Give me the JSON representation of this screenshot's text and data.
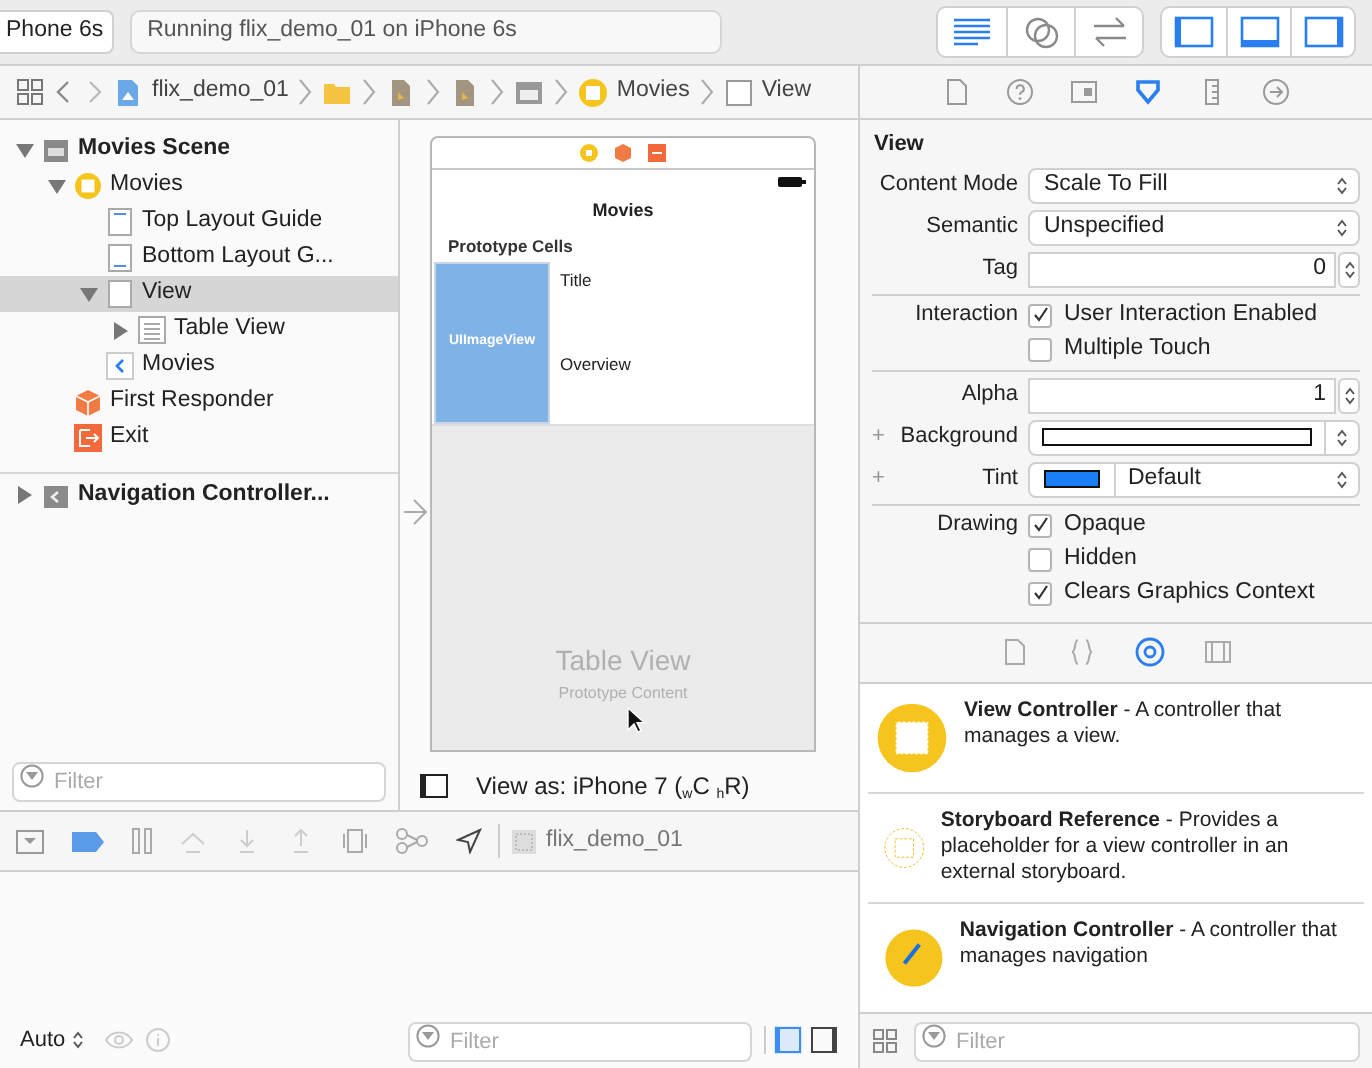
{
  "toolbar": {
    "scheme": "Phone 6s",
    "status": "Running flix_demo_01 on iPhone 6s",
    "editors": [
      {
        "kind": "standard",
        "selected": true
      },
      {
        "kind": "assistant",
        "selected": false
      },
      {
        "kind": "version",
        "selected": false
      }
    ],
    "panels": [
      {
        "kind": "left",
        "on": true
      },
      {
        "kind": "bottom",
        "on": true
      },
      {
        "kind": "right",
        "on": true
      }
    ]
  },
  "jump_bar": [
    {
      "kind": "project",
      "label": "flix_demo_01"
    },
    {
      "kind": "folder"
    },
    {
      "kind": "file"
    },
    {
      "kind": "file"
    },
    {
      "kind": "storyboard"
    },
    {
      "kind": "controller",
      "label": "Movies"
    },
    {
      "kind": "view",
      "label": "View"
    }
  ],
  "inspector_tabs": [
    {
      "kind": "file",
      "selected": false
    },
    {
      "kind": "help",
      "selected": false
    },
    {
      "kind": "identity",
      "selected": false
    },
    {
      "kind": "attributes",
      "selected": true
    },
    {
      "kind": "size",
      "selected": false
    },
    {
      "kind": "connections",
      "selected": false
    }
  ],
  "outline": {
    "items": [
      {
        "kind": "scene",
        "label": "Movies Scene",
        "expanded": true,
        "selected": false,
        "children": [
          {
            "kind": "controller",
            "label": "Movies",
            "expanded": true,
            "selected": false,
            "children": [
              {
                "kind": "top-guide",
                "label": "Top Layout Guide",
                "selected": false
              },
              {
                "kind": "bottom-guide",
                "label": "Bottom Layout G...",
                "selected": false
              },
              {
                "kind": "view",
                "label": "View",
                "expanded": true,
                "selected": true,
                "children": [
                  {
                    "kind": "table",
                    "label": "Table View",
                    "expanded": false,
                    "selected": false
                  }
                ]
              },
              {
                "kind": "nav-item",
                "label": "Movies",
                "selected": false
              }
            ]
          },
          {
            "kind": "responder",
            "label": "First Responder",
            "selected": false
          },
          {
            "kind": "exit",
            "label": "Exit",
            "selected": false
          }
        ]
      },
      {
        "kind": "nav-scene",
        "label": "Navigation Controller...",
        "expanded": false,
        "selected": false
      }
    ],
    "filter_placeholder": "Filter"
  },
  "canvas": {
    "nav_title": "Movies",
    "section_header": "Prototype Cells",
    "image_view": "UIImageView",
    "cell_labels": [
      "Title",
      "Overview"
    ],
    "table_title": "Table View",
    "table_subtitle": "Prototype Content",
    "view_as": "View as: iPhone 7 ($_{w}$C $_{h}$R)"
  },
  "debug_bar": {
    "breakpoints_on": true,
    "target": "flix_demo_01"
  },
  "console": {
    "mode": "Auto",
    "filter_placeholder": "Filter",
    "panes": [
      {
        "kind": "left",
        "on": true
      },
      {
        "kind": "right",
        "on": false
      }
    ]
  },
  "inspector": {
    "title": "View",
    "groups": [
      [
        {
          "kind": "popup",
          "label": "Content Mode",
          "value": "Scale To Fill"
        },
        {
          "kind": "popup",
          "label": "Semantic",
          "value": "Unspecified"
        },
        {
          "kind": "stepper",
          "label": "Tag",
          "value": "0"
        }
      ],
      [
        {
          "kind": "checkbox",
          "label": "Interaction",
          "text": "User Interaction Enabled",
          "checked": true
        },
        {
          "kind": "checkbox",
          "text": "Multiple Touch",
          "checked": false
        }
      ],
      [
        {
          "kind": "stepper",
          "label": "Alpha",
          "value": "1"
        },
        {
          "kind": "color",
          "plus": "+",
          "label": "Background",
          "color": "#ffffff"
        },
        {
          "kind": "color",
          "plus": "+",
          "label": "Tint",
          "color": "#1a7ef5",
          "value": "Default"
        }
      ],
      [
        {
          "kind": "checkbox",
          "label": "Drawing",
          "text": "Opaque",
          "checked": true
        },
        {
          "kind": "checkbox",
          "text": "Hidden",
          "checked": false
        },
        {
          "kind": "checkbox",
          "text": "Clears Graphics Context",
          "checked": true
        }
      ]
    ]
  },
  "library_tabs": [
    {
      "kind": "file",
      "selected": false
    },
    {
      "kind": "snippet",
      "selected": false
    },
    {
      "kind": "object",
      "selected": true
    },
    {
      "kind": "media",
      "selected": false
    }
  ],
  "library": {
    "items": [
      {
        "kind": "view-controller",
        "text": "**View Controller** - A controller that manages a view."
      },
      {
        "kind": "storyboard-reference",
        "text": "**Storyboard Reference** - Provides a placeholder for a view controller in an external storyboard."
      },
      {
        "kind": "navigation-controller",
        "text": "**Navigation Controller** - A controller that manages navigation"
      }
    ],
    "filter_placeholder": "Filter"
  }
}
